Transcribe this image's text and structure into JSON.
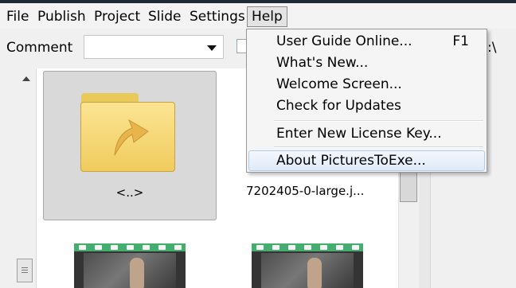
{
  "menubar": {
    "items": [
      {
        "label": "File"
      },
      {
        "label": "Publish"
      },
      {
        "label": "Project"
      },
      {
        "label": "Slide"
      },
      {
        "label": "Settings"
      },
      {
        "label": "Help",
        "active": true
      }
    ]
  },
  "toolbar": {
    "comment_label": "Comment",
    "comment_value": "",
    "path_tail": ":\\"
  },
  "browser": {
    "items": [
      {
        "label": "<..>",
        "type": "folder",
        "icon": "folder-up-arrow-icon"
      },
      {
        "label": "7202405-0-large.j...",
        "type": "image"
      },
      {
        "type": "video",
        "icon": "film-strip-icon"
      },
      {
        "type": "video",
        "icon": "film-strip-icon"
      }
    ]
  },
  "help_menu": {
    "items": [
      {
        "label": "User Guide Online...",
        "shortcut": "F1"
      },
      {
        "label": "What's New..."
      },
      {
        "label": "Welcome Screen..."
      },
      {
        "label": "Check for Updates"
      },
      {
        "label": "Enter New License Key..."
      },
      {
        "label": "About PicturesToExe...",
        "highlighted": true
      }
    ]
  },
  "colors": {
    "menu_highlight": "#dfeaf8",
    "folder": "#f0cc5e",
    "film_edge": "#45ad70"
  }
}
